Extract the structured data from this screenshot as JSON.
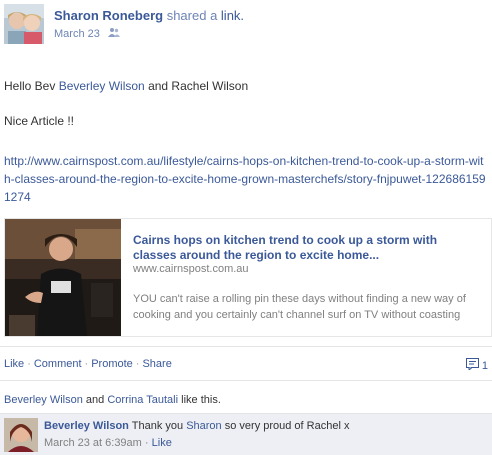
{
  "post": {
    "author": "Sharon Roneberg",
    "shared_text": "shared a",
    "shared_link": "link.",
    "date": "March 23",
    "audience_icon": "friends-icon"
  },
  "message": {
    "greeting_prefix": "Hello Bev",
    "mention1": "Beverley Wilson",
    "and_text": "and Rachel Wilson",
    "line2": "Nice Article !!",
    "url": "http://www.cairnspost.com.au/lifestyle/cairns-hops-on-kitchen-trend-to-cook-up-a-storm-with-classes-around-the-region-to-excite-home-grown-masterchefs/story-fnjpuwet-1226861591274"
  },
  "attachment": {
    "title": "Cairns hops on kitchen trend to cook up a storm with classes around the region to excite home...",
    "domain": "www.cairnspost.com.au",
    "description": "YOU can't raise a rolling pin these days without finding a new way of cooking and you certainly can't channel surf on TV without coasting"
  },
  "actions": {
    "like": "Like",
    "comment": "Comment",
    "promote": "Promote",
    "share": "Share",
    "comment_count": "1"
  },
  "likes": {
    "person1": "Beverley Wilson",
    "and_text": "and",
    "person2": "Corrina Tautali",
    "suffix": "like this."
  },
  "comment": {
    "author": "Beverley Wilson",
    "text_prefix": "Thank you",
    "mention": "Sharon",
    "text_suffix": "so very proud of Rachel x",
    "time": "March 23 at 6:39am",
    "like": "Like"
  },
  "colors": {
    "link": "#3b5998",
    "meta": "#6d84b4",
    "ufi_background": "#edeff4"
  }
}
